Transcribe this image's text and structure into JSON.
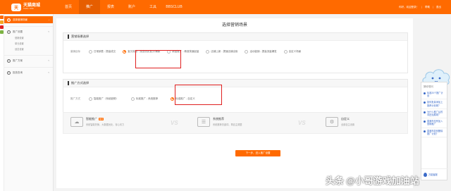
{
  "header": {
    "logo_badge": "天",
    "logo_title": "天猫商城",
    "logo_sub": "TMALL.COM",
    "nav": [
      {
        "label": "首页",
        "active": false
      },
      {
        "label": "推广",
        "active": true
      },
      {
        "label": "报表",
        "active": false
      },
      {
        "label": "账户",
        "active": false
      },
      {
        "label": "工具",
        "active": false
      },
      {
        "label": "BBSCLUB",
        "active": false
      }
    ],
    "user_info": "你好，欢迎登录！",
    "help": "帮助",
    "logout": "退出"
  },
  "sidebar": {
    "active_item": "选择营销场景",
    "group1_title": "推广设置",
    "group1_items": [
      "营销设置",
      "单元设置",
      "创意设置"
    ],
    "group2_title": "推广方案",
    "group3_title": "投放查询"
  },
  "main": {
    "page_title": "选择营销场景",
    "section1": {
      "title": "营销场景选择",
      "row_label": "营销目标",
      "options": [
        {
          "label": "日常销售 - 提高成交",
          "selected": false
        },
        {
          "label": "宝贝测款 - 找出优质宝贝/爆款",
          "selected": true
        },
        {
          "label": "新品推广 - 精准快速起量",
          "selected": false
        },
        {
          "label": "店铺上新 - 提速店铺出街",
          "selected": false
        },
        {
          "label": "活动促销 - 提高流量爆发",
          "selected": false
        },
        {
          "label": "自定义场景",
          "selected": false
        }
      ]
    },
    "section2": {
      "title": "推广方式选择",
      "row_label": "推广方式",
      "options": [
        {
          "label": "智能推广（系统趋势）",
          "selected": false
        },
        {
          "label": "标准推广 - 系统推荐",
          "selected": false
        },
        {
          "label": "标准推广 - 自定义",
          "selected": true
        }
      ]
    },
    "compare": {
      "items": [
        {
          "title": "智能推广",
          "tag": "推荐",
          "desc": "系统智能托管，大数据优化，省心省力",
          "icon": "lightning-cloud-icon"
        },
        {
          "title": "系统推荐",
          "tag": "",
          "desc": "系统推荐关键词，再自主调整",
          "icon": "sliders-icon"
        },
        {
          "title": "自定义",
          "tag": "",
          "desc": "全部自主设置",
          "icon": "gears-icon"
        }
      ],
      "vs": "VS"
    },
    "next_button": "下一步，进入推广设置"
  },
  "help_panel": {
    "title": "猜你想问",
    "items": [
      "标准20个推广计划",
      "如何批量添加上推荐计划呢？",
      "为什么推广后的词还没展现？",
      "直通车没有加入营销推广",
      "直通车如何删除推广计划？"
    ],
    "bottom_label": "万能客服"
  },
  "watermark": {
    "prefix": "头条",
    "text": "@小哥游戏加油站"
  },
  "colors": {
    "brand": "#ff6a00",
    "highlight_box": "#e02020",
    "link": "#3a6ac8"
  }
}
